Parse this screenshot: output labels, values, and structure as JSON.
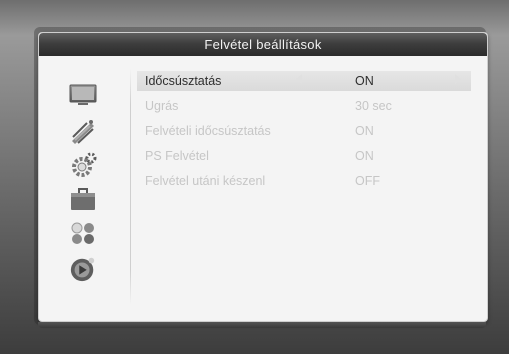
{
  "window": {
    "title": "Felvétel beállítások"
  },
  "sidebar": {
    "icons": [
      {
        "name": "tv-monitor-icon"
      },
      {
        "name": "satellite-dish-icon"
      },
      {
        "name": "gear-settings-icon"
      },
      {
        "name": "briefcase-icon"
      },
      {
        "name": "dots-games-icon"
      },
      {
        "name": "record-media-icon"
      }
    ]
  },
  "menu": {
    "items": [
      {
        "label": "Időcsúsztatás",
        "value": "ON"
      },
      {
        "label": "Ugrás",
        "value": "30 sec"
      },
      {
        "label": "Felvételi időcsúsztatás",
        "value": "ON"
      },
      {
        "label": "PS Felvétel",
        "value": "ON"
      },
      {
        "label": "Felvétel utáni készenl",
        "value": "OFF"
      }
    ]
  },
  "colors": {
    "title_bar": "#3a3a3a",
    "panel": "#f4f4f4",
    "selected_row": "#dedede",
    "inactive_text": "#c6c6c6",
    "active_text": "#2e2e2e"
  }
}
